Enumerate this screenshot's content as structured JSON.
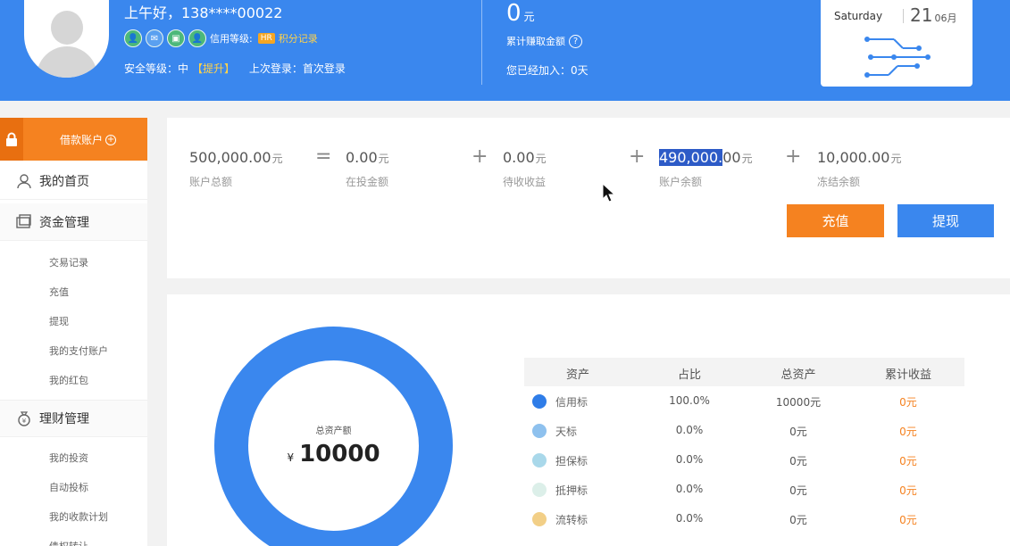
{
  "header": {
    "greeting": "上午好，138****00022",
    "credit_level_label": "信用等级:",
    "credit_badge": "HR",
    "points_link": "积分记录",
    "safety_label": "安全等级：中",
    "safety_upgrade": "【提升】",
    "last_login": "上次登录：首次登录",
    "earnings_value": "0",
    "earnings_unit": "元",
    "earnings_label": "累计赚取金额",
    "joined": "您已经加入：0天",
    "date_weekday": "Saturday",
    "date_day": "21",
    "date_month": "06月"
  },
  "sidebar": {
    "loan_button": "借款账户",
    "home": "我的首页",
    "funds": "资金管理",
    "funds_items": [
      "交易记录",
      "充值",
      "提现",
      "我的支付账户",
      "我的红包"
    ],
    "wealth": "理财管理",
    "wealth_items": [
      "我的投资",
      "自动投标",
      "我的收款计划",
      "债权转让"
    ]
  },
  "balances": {
    "total": {
      "value": "500,000.00",
      "unit": "元",
      "label": "账户总额"
    },
    "invested": {
      "value": "0.00",
      "unit": "元",
      "label": "在投金额"
    },
    "pending": {
      "value": "0.00",
      "unit": "元",
      "label": "待收收益"
    },
    "available": {
      "value_highlight": "490,000.",
      "value_rest": "00",
      "unit": "元",
      "label": "账户余额"
    },
    "frozen": {
      "value": "10,000.00",
      "unit": "元",
      "label": "冻结余额"
    },
    "op_equals": "=",
    "op_plus": "+"
  },
  "actions": {
    "recharge": "充值",
    "withdraw": "提现"
  },
  "donut": {
    "label": "总资产额",
    "currency": "¥",
    "value": "10000"
  },
  "table": {
    "headers": [
      "资产",
      "占比",
      "总资产",
      "累计收益"
    ],
    "rows": [
      {
        "name": "信用标",
        "ratio": "100.0%",
        "total": "10000元",
        "income": "0元",
        "color": "#2f7de8"
      },
      {
        "name": "天标",
        "ratio": "0.0%",
        "total": "0元",
        "income": "0元",
        "color": "#8ec1ee"
      },
      {
        "name": "担保标",
        "ratio": "0.0%",
        "total": "0元",
        "income": "0元",
        "color": "#a9d8ea"
      },
      {
        "name": "抵押标",
        "ratio": "0.0%",
        "total": "0元",
        "income": "0元",
        "color": "#dcefe9"
      },
      {
        "name": "流转标",
        "ratio": "0.0%",
        "total": "0元",
        "income": "0元",
        "color": "#f2cf87"
      }
    ]
  }
}
